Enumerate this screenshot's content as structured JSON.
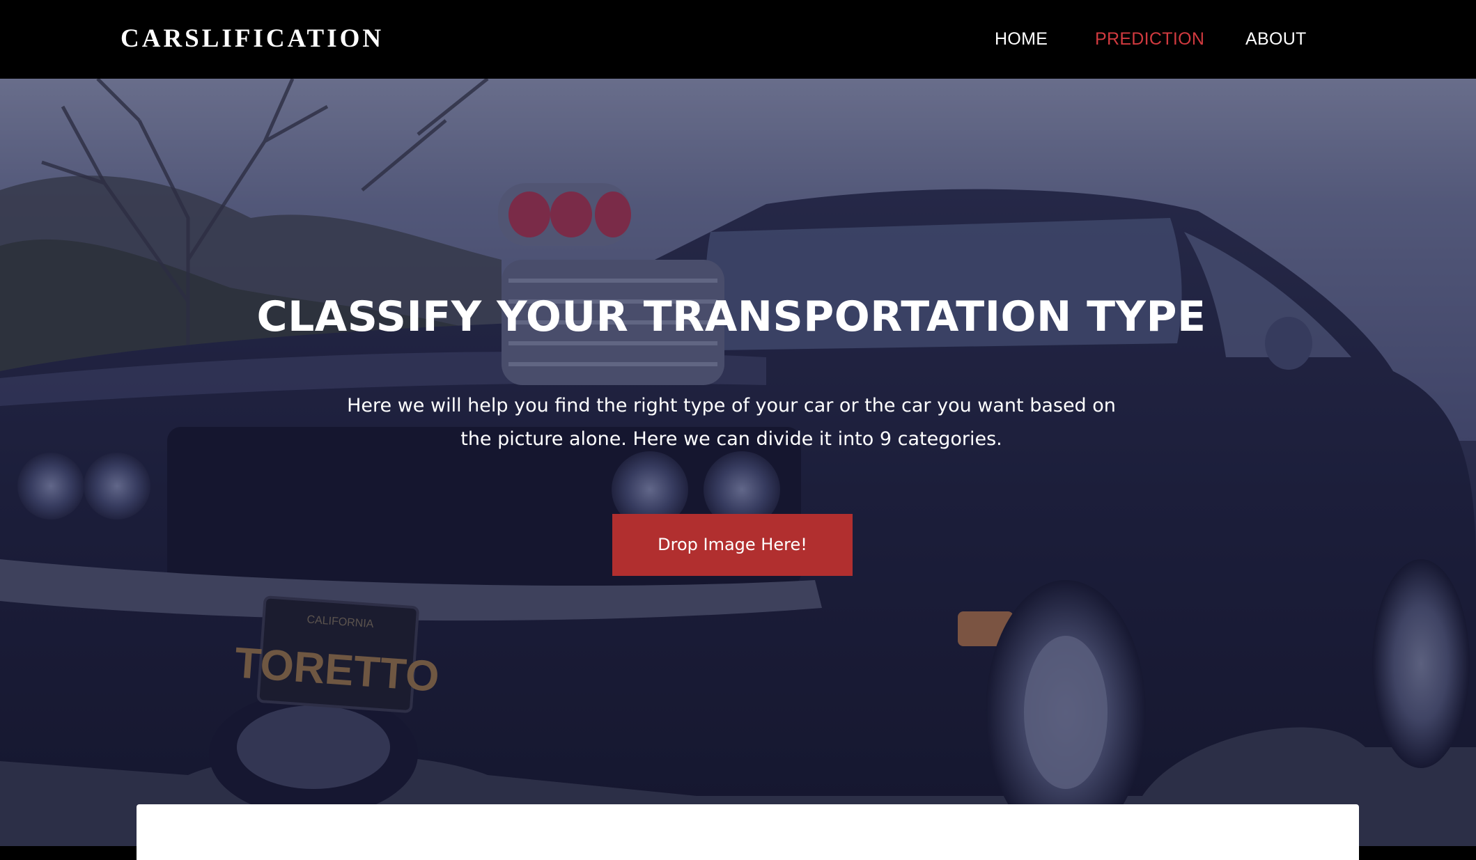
{
  "brand": "CARSLIFICATION",
  "nav": {
    "items": [
      {
        "label": "HOME",
        "active": false
      },
      {
        "label": "PREDICTION",
        "active": true
      },
      {
        "label": "ABOUT",
        "active": false
      }
    ]
  },
  "hero": {
    "title": "CLASSIFY YOUR TRANSPORTATION TYPE",
    "description_line1": "Here we will help you find the right type of your car or the car you want based on",
    "description_line2": "the picture alone. Here we can divide it into 9 categories.",
    "button_label": "Drop Image Here!",
    "plate_text": "TORETTO",
    "plate_state": "CALIFORNIA"
  },
  "colors": {
    "navbar_bg": "#000000",
    "active_nav": "#d13a3f",
    "button_bg": "#b12f2f",
    "overlay": "#1c1e48"
  }
}
